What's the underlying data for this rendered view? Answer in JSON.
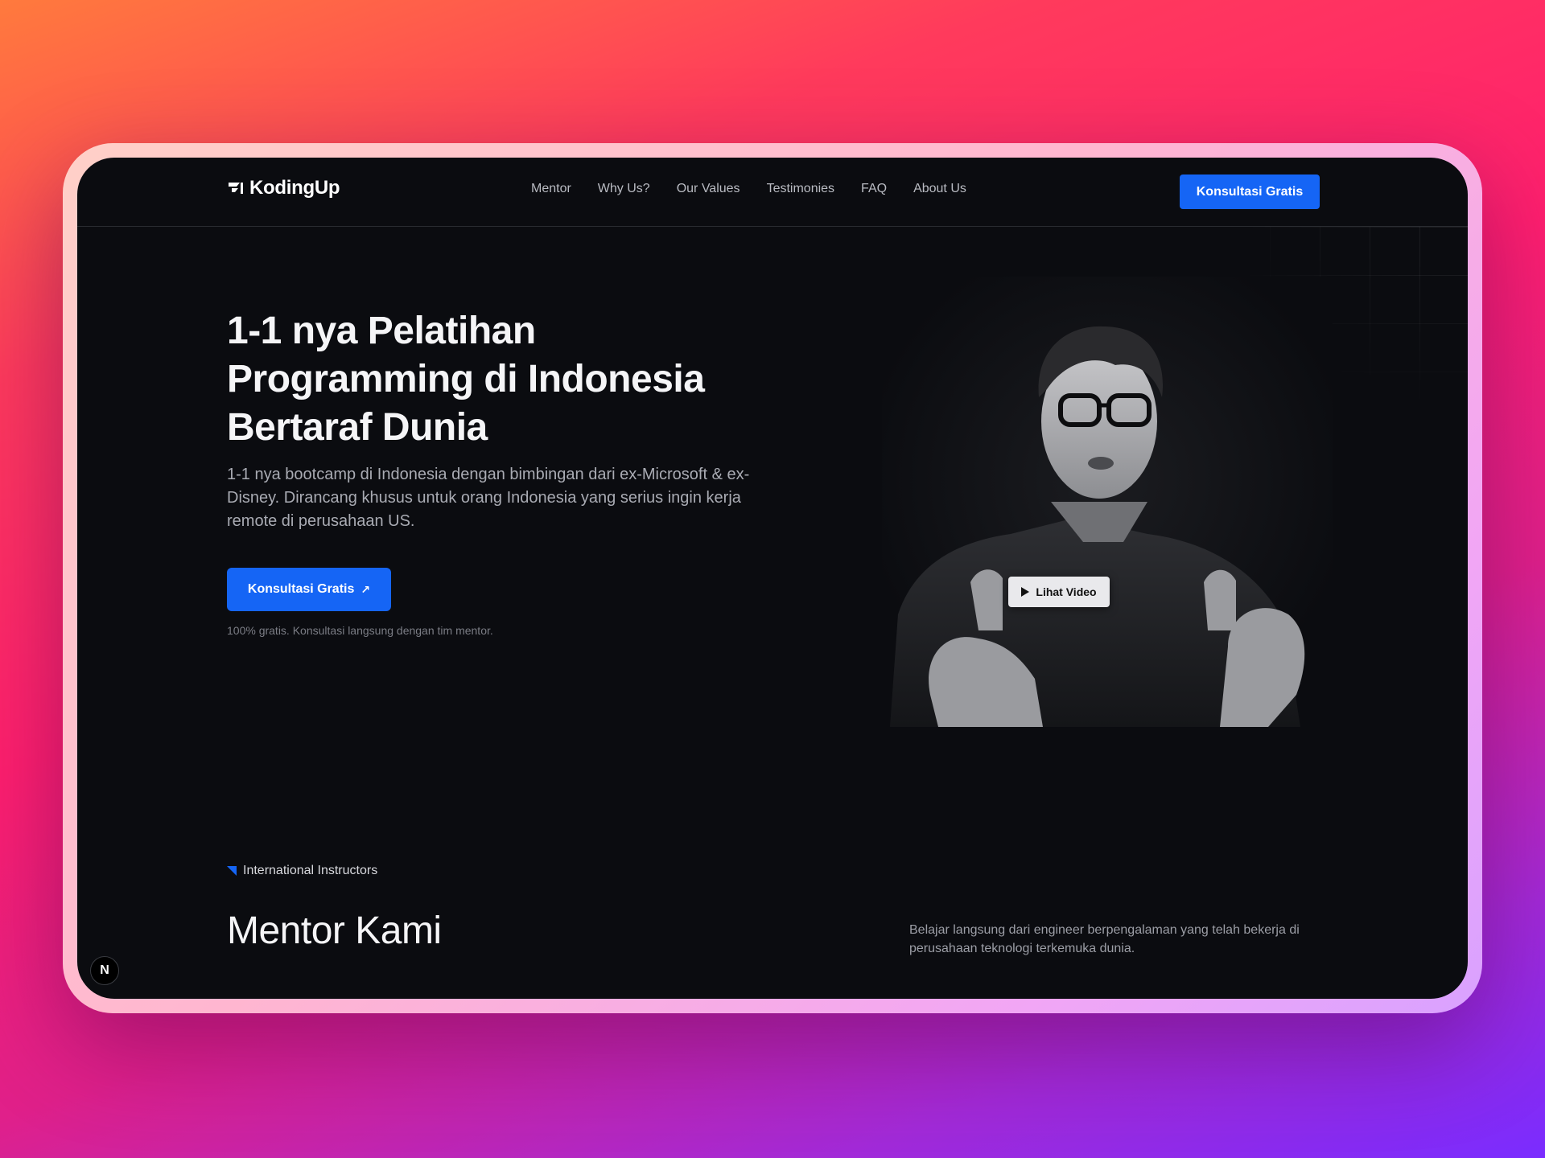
{
  "brand": {
    "name": "KodingUp",
    "logo_icon": "kodingup-logo-icon"
  },
  "nav": {
    "links": [
      "Mentor",
      "Why Us?",
      "Our Values",
      "Testimonies",
      "FAQ",
      "About Us"
    ],
    "cta_label": "Konsultasi Gratis"
  },
  "hero": {
    "title": "1-1 nya Pelatihan Programming di Indonesia Bertaraf Dunia",
    "description": "1-1 nya bootcamp di Indonesia dengan bimbingan dari ex-Microsoft & ex-Disney. Dirancang khusus untuk orang Indonesia yang serius ingin kerja remote di perusahaan US.",
    "cta_label": "Konsultasi Gratis",
    "cta_icon": "arrow-up-right-icon",
    "note": "100% gratis. Konsultasi langsung dengan tim mentor."
  },
  "video": {
    "play_label": "Lihat Video",
    "play_icon": "play-icon"
  },
  "mentor_section": {
    "eyebrow": "International Instructors",
    "title": "Mentor Kami",
    "description": "Belajar langsung dari engineer berpengalaman yang telah bekerja di perusahaan teknologi terkemuka dunia."
  },
  "dev_badge": {
    "label": "N"
  },
  "colors": {
    "accent": "#1565f5",
    "page_bg": "#0b0c10",
    "frame_gradient_start": "#ff7a3d",
    "frame_gradient_end": "#7a2cff"
  }
}
